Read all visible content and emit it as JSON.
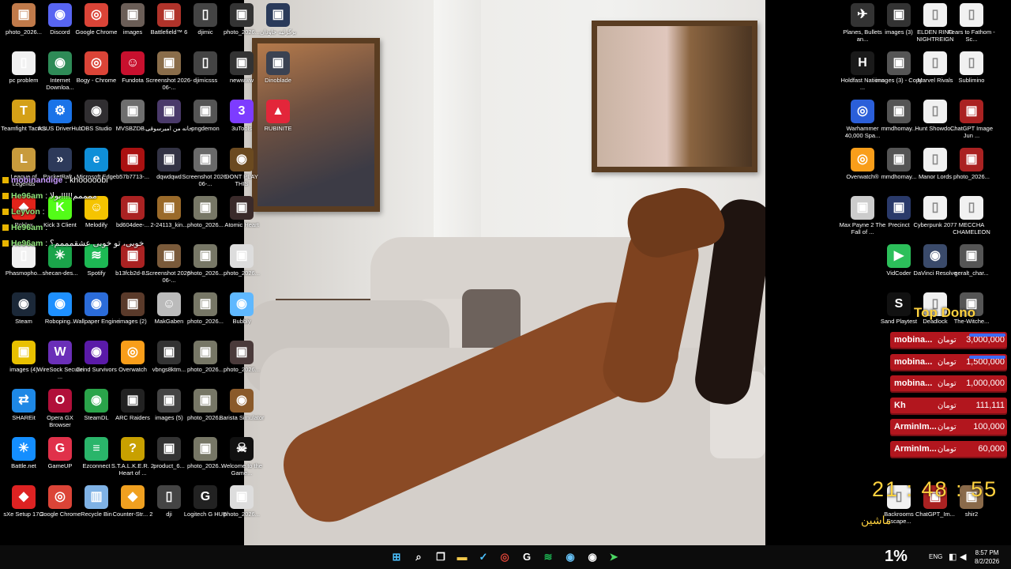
{
  "desktop": {
    "icons_left": [
      {
        "label": "photo_2026...",
        "icon": "photo-icon",
        "color": "#c07a4a",
        "glyph": "▣"
      },
      {
        "label": "Discord",
        "icon": "discord-icon",
        "color": "#5865f2",
        "glyph": "◉"
      },
      {
        "label": "Google Chrome",
        "icon": "chrome-icon",
        "color": "#db4437",
        "glyph": "◎"
      },
      {
        "label": "images",
        "icon": "image-icon",
        "color": "#6b5e57",
        "glyph": "▣"
      },
      {
        "label": "Battlefield™ 6",
        "icon": "battlefield-icon",
        "color": "#b0332a",
        "glyph": "▣"
      },
      {
        "label": "djimic",
        "icon": "file-icon",
        "color": "#444",
        "glyph": "▯"
      },
      {
        "label": "photo_2026...",
        "icon": "photo-icon",
        "color": "#333",
        "glyph": "▣"
      },
      {
        "label": "برگرلیه جاودان",
        "icon": "photo-icon",
        "color": "#2a3a5a",
        "glyph": "▣"
      },
      {
        "label": "pc problem",
        "icon": "document-icon",
        "color": "#f1f1f1",
        "glyph": "▯"
      },
      {
        "label": "Internet Downloa...",
        "icon": "idm-icon",
        "color": "#2e8b57",
        "glyph": "◉"
      },
      {
        "label": "Bogy - Chrome",
        "icon": "chrome-icon",
        "color": "#db4437",
        "glyph": "◎"
      },
      {
        "label": "Fundota",
        "icon": "fundota-icon",
        "color": "#c8102e",
        "glyph": "☺"
      },
      {
        "label": "Screenshot 2026-06-...",
        "icon": "screenshot-icon",
        "color": "#8a6d4a",
        "glyph": "▣"
      },
      {
        "label": "djimicsss",
        "icon": "file-icon",
        "color": "#444",
        "glyph": "▯"
      },
      {
        "label": "newwww",
        "icon": "photo-icon",
        "color": "#333",
        "glyph": "▣"
      },
      {
        "label": "Dinoblade",
        "icon": "dinoblade-icon",
        "color": "#3b4252",
        "glyph": "▣"
      },
      {
        "label": "Teamfight Tactics",
        "icon": "tft-icon",
        "color": "#d4a017",
        "glyph": "T"
      },
      {
        "label": "ASUS DriverHub",
        "icon": "gear-icon",
        "color": "#1a73e8",
        "glyph": "⚙"
      },
      {
        "label": "OBS Studio",
        "icon": "obs-icon",
        "color": "#302e31",
        "glyph": "◉"
      },
      {
        "label": "MVSBZDB...",
        "icon": "photo-icon",
        "color": "#6e6e6e",
        "glyph": "▣"
      },
      {
        "label": "خانه من امیرسوقی",
        "icon": "photo-icon",
        "color": "#4a3a6a",
        "glyph": "▣"
      },
      {
        "label": "pngdemon",
        "icon": "photo-icon",
        "color": "#555",
        "glyph": "▣"
      },
      {
        "label": "3uTools",
        "icon": "3utools-icon",
        "color": "#7d3cff",
        "glyph": "3"
      },
      {
        "label": "RUBINITE",
        "icon": "rubinite-icon",
        "color": "#e3263a",
        "glyph": "▲"
      },
      {
        "label": "League of Legends",
        "icon": "lol-icon",
        "color": "#c89b3c",
        "glyph": "L"
      },
      {
        "label": "PacketRaft...",
        "icon": "app-icon",
        "color": "#2d3a5a",
        "glyph": "»"
      },
      {
        "label": "Microsoft Edge",
        "icon": "edge-icon",
        "color": "#0f8fd8",
        "glyph": "e"
      },
      {
        "label": "b57b7713-...",
        "icon": "photo-icon",
        "color": "#a11",
        "glyph": "▣"
      },
      {
        "label": "dqwdqwd",
        "icon": "photo-icon",
        "color": "#334",
        "glyph": "▣"
      },
      {
        "label": "Screenshot 2026-06-...",
        "icon": "screenshot-icon",
        "color": "#6a6a6a",
        "glyph": "▣"
      },
      {
        "label": "DONT PLAY THIS",
        "icon": "app-icon",
        "color": "#6b4a20",
        "glyph": "◉"
      },
      {
        "label": "Roblox",
        "icon": "roblox-icon",
        "color": "#e2231a",
        "glyph": "◆"
      },
      {
        "label": "Kick 3 Client",
        "icon": "kick-icon",
        "color": "#53fc18",
        "glyph": "K"
      },
      {
        "label": "Melodify",
        "icon": "melodify-icon",
        "color": "#f5c400",
        "glyph": "☺"
      },
      {
        "label": "bd604dee-...",
        "icon": "photo-icon",
        "color": "#a22",
        "glyph": "▣"
      },
      {
        "label": "2-24113_kin...",
        "icon": "photo-icon",
        "color": "#9a6a2a",
        "glyph": "▣"
      },
      {
        "label": "photo_2026...",
        "icon": "photo-icon",
        "color": "#776",
        "glyph": "▣"
      },
      {
        "label": "Atomic Heart",
        "icon": "app-icon",
        "color": "#3a2a2a",
        "glyph": "▣"
      },
      {
        "label": "Phasmopho...",
        "icon": "document-icon",
        "color": "#f1f1f1",
        "glyph": "▯"
      },
      {
        "label": "shecan-des...",
        "icon": "network-icon",
        "color": "#1aa44a",
        "glyph": "✳"
      },
      {
        "label": "Spotify",
        "icon": "spotify-icon",
        "color": "#1db954",
        "glyph": "≋"
      },
      {
        "label": "b13fcb2d-8...",
        "icon": "photo-icon",
        "color": "#a22",
        "glyph": "▣"
      },
      {
        "label": "Screenshot 2026-06-...",
        "icon": "screenshot-icon",
        "color": "#7a5a3a",
        "glyph": "▣"
      },
      {
        "label": "photo_2026...",
        "icon": "photo-icon",
        "color": "#776",
        "glyph": "▣"
      },
      {
        "label": "photo_2026...",
        "icon": "photo-icon",
        "color": "#ddd",
        "glyph": "▣"
      },
      {
        "label": "Steam",
        "icon": "steam-icon",
        "color": "#1b2838",
        "glyph": "◉"
      },
      {
        "label": "Roboping...",
        "icon": "roboping-icon",
        "color": "#1e90ff",
        "glyph": "◉"
      },
      {
        "label": "Wallpaper Engine",
        "icon": "wallpaper-engine-icon",
        "color": "#2b6cd9",
        "glyph": "◉"
      },
      {
        "label": "images (2)",
        "icon": "photo-icon",
        "color": "#5a3a2a",
        "glyph": "▣"
      },
      {
        "label": "MakGaben",
        "icon": "photo-icon",
        "color": "#bbb",
        "glyph": "☺"
      },
      {
        "label": "photo_2026...",
        "icon": "photo-icon",
        "color": "#776",
        "glyph": "▣"
      },
      {
        "label": "Bubbly",
        "icon": "bubbly-icon",
        "color": "#5fb8ff",
        "glyph": "◉"
      },
      {
        "label": "images (4)",
        "icon": "photo-icon",
        "color": "#e8c000",
        "glyph": "▣"
      },
      {
        "label": "WireSock Secure ...",
        "icon": "wiresock-icon",
        "color": "#6a2fb8",
        "glyph": "W"
      },
      {
        "label": "Grind Survivors",
        "icon": "app-icon",
        "color": "#5a1aa8",
        "glyph": "◉"
      },
      {
        "label": "Overwatch",
        "icon": "overwatch-icon",
        "color": "#f99e1a",
        "glyph": "◎"
      },
      {
        "label": "vbngs8ktm...",
        "icon": "photo-icon",
        "color": "#333",
        "glyph": "▣"
      },
      {
        "label": "photo_2026...",
        "icon": "photo-icon",
        "color": "#776",
        "glyph": "▣"
      },
      {
        "label": "photo_2026...",
        "icon": "photo-icon",
        "color": "#4a3a3a",
        "glyph": "▣"
      },
      {
        "label": "SHAREit",
        "icon": "shareit-icon",
        "color": "#1e88e5",
        "glyph": "⇄"
      },
      {
        "label": "Opera GX Browser",
        "icon": "opera-gx-icon",
        "color": "#b1103a",
        "glyph": "O"
      },
      {
        "label": "SteamDL",
        "icon": "steamdl-icon",
        "color": "#2aa44a",
        "glyph": "◉"
      },
      {
        "label": "ARC Raiders",
        "icon": "arc-raiders-icon",
        "color": "#222",
        "glyph": "▣"
      },
      {
        "label": "images (5)",
        "icon": "photo-icon",
        "color": "#444",
        "glyph": "▣"
      },
      {
        "label": "photo_2026...",
        "icon": "photo-icon",
        "color": "#776",
        "glyph": "▣"
      },
      {
        "label": "Barista Simulator",
        "icon": "app-icon",
        "color": "#8a5a2a",
        "glyph": "◉"
      },
      {
        "label": "Battle.net",
        "icon": "battlenet-icon",
        "color": "#148eff",
        "glyph": "✳"
      },
      {
        "label": "GameUP",
        "icon": "gameup-icon",
        "color": "#e0314a",
        "glyph": "G"
      },
      {
        "label": "Ezconnect",
        "icon": "ezconnect-icon",
        "color": "#2ab56a",
        "glyph": "≡"
      },
      {
        "label": "S.T.A.L.K.E.R. 2 Heart of ...",
        "icon": "stalker-icon",
        "color": "#c8a000",
        "glyph": "?"
      },
      {
        "label": "product_6...",
        "icon": "photo-icon",
        "color": "#333",
        "glyph": "▣"
      },
      {
        "label": "photo_2026...",
        "icon": "photo-icon",
        "color": "#776",
        "glyph": "▣"
      },
      {
        "label": "Welcome to the Game...",
        "icon": "app-icon",
        "color": "#111",
        "glyph": "☠"
      },
      {
        "label": "sXe Setup 17.2",
        "icon": "sxe-icon",
        "color": "#d22",
        "glyph": "◆"
      },
      {
        "label": "Google Chrome",
        "icon": "chrome-icon",
        "color": "#db4437",
        "glyph": "◎"
      },
      {
        "label": "Recycle Bin",
        "icon": "recycle-bin-icon",
        "color": "#7fb2e5",
        "glyph": "▥"
      },
      {
        "label": "Counter-Str... 2",
        "icon": "cs2-icon",
        "color": "#f0a020",
        "glyph": "◆"
      },
      {
        "label": "dji",
        "icon": "file-icon",
        "color": "#444",
        "glyph": "▯"
      },
      {
        "label": "Logitech G HUB",
        "icon": "logitech-icon",
        "color": "#222",
        "glyph": "G"
      },
      {
        "label": "photo_2026...",
        "icon": "photo-icon",
        "color": "#ddd",
        "glyph": "▣"
      }
    ],
    "icons_right": [
      {
        "label": "Planes, Bullets an...",
        "icon": "app-icon",
        "color": "#333",
        "glyph": "✈"
      },
      {
        "label": "images (3)",
        "icon": "photo-icon",
        "color": "#333",
        "glyph": "▣"
      },
      {
        "label": "ELDEN RING NIGHTREIGN",
        "icon": "document-icon",
        "color": "#f1f1f1",
        "glyph": "▯"
      },
      {
        "label": "Fears to Fathom - Sc...",
        "icon": "document-icon",
        "color": "#f1f1f1",
        "glyph": "▯"
      },
      {
        "label": "Holdfast Nations ...",
        "icon": "holdfast-icon",
        "color": "#1a1a1a",
        "glyph": "H"
      },
      {
        "label": "images (3) - Copy",
        "icon": "photo-icon",
        "color": "#555",
        "glyph": "▣"
      },
      {
        "label": "Marvel Rivals",
        "icon": "document-icon",
        "color": "#f1f1f1",
        "glyph": "▯"
      },
      {
        "label": "Sublimino",
        "icon": "document-icon",
        "color": "#f1f1f1",
        "glyph": "▯"
      },
      {
        "label": "Warhammer 40,000 Spa...",
        "icon": "warhammer-icon",
        "color": "#2b5fd9",
        "glyph": "◎"
      },
      {
        "label": "mmdhomay...",
        "icon": "photo-icon",
        "color": "#555",
        "glyph": "▣"
      },
      {
        "label": "Hunt Showdo...",
        "icon": "document-icon",
        "color": "#f1f1f1",
        "glyph": "▯"
      },
      {
        "label": "ChatGPT Image Jun ...",
        "icon": "photo-icon",
        "color": "#a22",
        "glyph": "▣"
      },
      {
        "label": "Overwatch®",
        "icon": "overwatch-icon",
        "color": "#f99e1a",
        "glyph": "◎"
      },
      {
        "label": "mmdhomay...",
        "icon": "photo-icon",
        "color": "#555",
        "glyph": "▣"
      },
      {
        "label": "Manor Lords",
        "icon": "document-icon",
        "color": "#f1f1f1",
        "glyph": "▯"
      },
      {
        "label": "photo_2026...",
        "icon": "photo-icon",
        "color": "#a22",
        "glyph": "▣"
      },
      {
        "label": "Max Payne 2 The Fall of ...",
        "icon": "maxpayne-icon",
        "color": "#ccc",
        "glyph": "▣"
      },
      {
        "label": "Precinct",
        "icon": "precinct-icon",
        "color": "#2a3a6a",
        "glyph": "▣"
      },
      {
        "label": "Cyberpunk 2077",
        "icon": "document-icon",
        "color": "#f1f1f1",
        "glyph": "▯"
      },
      {
        "label": "MECCHA CHAMELEON",
        "icon": "document-icon",
        "color": "#f1f1f1",
        "glyph": "▯"
      },
      {
        "label": "VidCoder",
        "icon": "vidcoder-icon",
        "color": "#2cbf5a",
        "glyph": "▶"
      },
      {
        "label": "DaVinci Resolve",
        "icon": "davinci-icon",
        "color": "#3a4a6a",
        "glyph": "◉"
      },
      {
        "label": "geralt_char...",
        "icon": "photo-icon",
        "color": "#555",
        "glyph": "▣"
      },
      {
        "label": "Sand Playtest",
        "icon": "sand-icon",
        "color": "#111",
        "glyph": "S"
      },
      {
        "label": "Deadlock",
        "icon": "document-icon",
        "color": "#f1f1f1",
        "glyph": "▯"
      },
      {
        "label": "The-Witche...",
        "icon": "photo-icon",
        "color": "#555",
        "glyph": "▣"
      },
      {
        "label": "Backrooms Escape...",
        "icon": "document-icon",
        "color": "#f1f1f1",
        "glyph": "▯"
      },
      {
        "label": "ChatGPT_Im...",
        "icon": "photo-icon",
        "color": "#a22",
        "glyph": "▣"
      },
      {
        "label": "shir2",
        "icon": "photo-icon",
        "color": "#8a6a4a",
        "glyph": "▣"
      }
    ]
  },
  "chat": [
    {
      "user": "mobinandige",
      "sep": " : ",
      "message": "khooooobi",
      "color": "purple"
    },
    {
      "user": "He96am",
      "sep": " : ",
      "message": "ممممم!!!!!بولا",
      "color": "green"
    },
    {
      "user": "Leyvon",
      "sep": " : ",
      "message": "",
      "color": "green"
    },
    {
      "user": "He96am",
      "sep": " : ",
      "message": "",
      "color": "green"
    },
    {
      "user": "He96am",
      "sep": " : ",
      "message": "خوبی، تو خوبی عشقمممم؟",
      "color": "green"
    }
  ],
  "top_dono": {
    "title": "Top Dono",
    "currency": "تومان",
    "rows": [
      {
        "name": "mobina...",
        "amount": "3,000,000",
        "accent_bar": true
      },
      {
        "name": "mobina...",
        "amount": "1,500,000",
        "accent_bar": true
      },
      {
        "name": "mobina...",
        "amount": "1,000,000",
        "accent_bar": false
      },
      {
        "name": "Kh",
        "amount": "111,111",
        "accent_bar": false
      },
      {
        "name": "ArminIm...",
        "amount": "100,000",
        "accent_bar": false
      },
      {
        "name": "ArminIm...",
        "amount": "60,000",
        "accent_bar": false
      }
    ]
  },
  "overlay_clock": {
    "time": "21 : 48 : 55",
    "subtitle": "ماشین"
  },
  "taskbar": {
    "apps": [
      {
        "name": "start-button",
        "icon": "windows-icon",
        "glyph": "⊞",
        "color": "#4cc2ff"
      },
      {
        "name": "search-button",
        "icon": "search-icon",
        "glyph": "⌕",
        "color": "#ffffff"
      },
      {
        "name": "task-view-button",
        "icon": "task-view-icon",
        "glyph": "❐",
        "color": "#ffffff"
      },
      {
        "name": "file-explorer-button",
        "icon": "folder-icon",
        "glyph": "▬",
        "color": "#f2c94c"
      },
      {
        "name": "vscode-button",
        "icon": "check-icon",
        "glyph": "✓",
        "color": "#4cc2ff"
      },
      {
        "name": "chrome-button",
        "icon": "chrome-icon",
        "glyph": "◎",
        "color": "#db4437"
      },
      {
        "name": "logitech-button",
        "icon": "logitech-icon",
        "glyph": "G",
        "color": "#ffffff"
      },
      {
        "name": "spotify-button",
        "icon": "spotify-icon",
        "glyph": "≋",
        "color": "#1db954"
      },
      {
        "name": "steam-button",
        "icon": "steam-icon",
        "glyph": "◉",
        "color": "#66c0f4"
      },
      {
        "name": "obs-button",
        "icon": "obs-icon",
        "glyph": "◉",
        "color": "#ffffff"
      },
      {
        "name": "messaging-button",
        "icon": "send-icon",
        "glyph": "➤",
        "color": "#4cd964"
      }
    ],
    "tray": {
      "battery_percent": "1%",
      "language": "ENG",
      "time": "8:57 PM",
      "date": "8/2/2026"
    }
  }
}
